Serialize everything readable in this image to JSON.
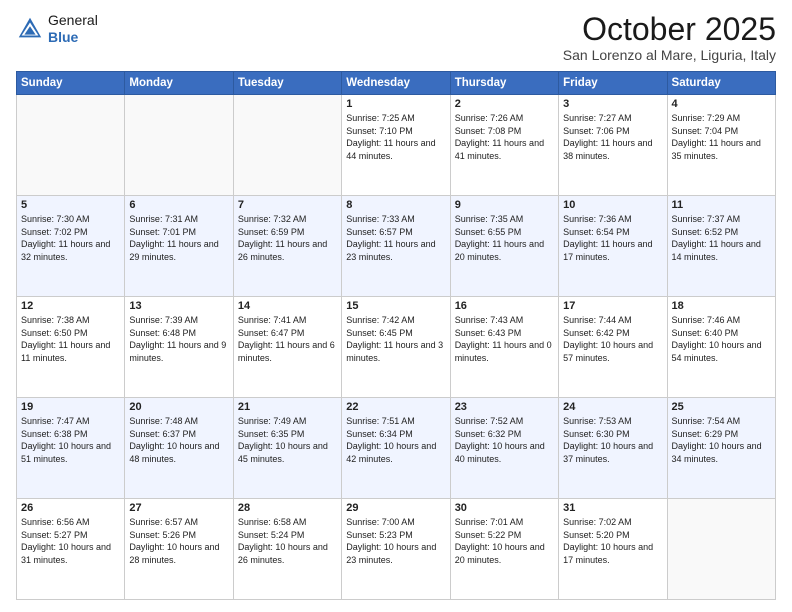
{
  "header": {
    "logo_general": "General",
    "logo_blue": "Blue",
    "month": "October 2025",
    "location": "San Lorenzo al Mare, Liguria, Italy"
  },
  "days_of_week": [
    "Sunday",
    "Monday",
    "Tuesday",
    "Wednesday",
    "Thursday",
    "Friday",
    "Saturday"
  ],
  "weeks": [
    [
      {
        "day": "",
        "sunrise": "",
        "sunset": "",
        "daylight": ""
      },
      {
        "day": "",
        "sunrise": "",
        "sunset": "",
        "daylight": ""
      },
      {
        "day": "",
        "sunrise": "",
        "sunset": "",
        "daylight": ""
      },
      {
        "day": "1",
        "sunrise": "Sunrise: 7:25 AM",
        "sunset": "Sunset: 7:10 PM",
        "daylight": "Daylight: 11 hours and 44 minutes."
      },
      {
        "day": "2",
        "sunrise": "Sunrise: 7:26 AM",
        "sunset": "Sunset: 7:08 PM",
        "daylight": "Daylight: 11 hours and 41 minutes."
      },
      {
        "day": "3",
        "sunrise": "Sunrise: 7:27 AM",
        "sunset": "Sunset: 7:06 PM",
        "daylight": "Daylight: 11 hours and 38 minutes."
      },
      {
        "day": "4",
        "sunrise": "Sunrise: 7:29 AM",
        "sunset": "Sunset: 7:04 PM",
        "daylight": "Daylight: 11 hours and 35 minutes."
      }
    ],
    [
      {
        "day": "5",
        "sunrise": "Sunrise: 7:30 AM",
        "sunset": "Sunset: 7:02 PM",
        "daylight": "Daylight: 11 hours and 32 minutes."
      },
      {
        "day": "6",
        "sunrise": "Sunrise: 7:31 AM",
        "sunset": "Sunset: 7:01 PM",
        "daylight": "Daylight: 11 hours and 29 minutes."
      },
      {
        "day": "7",
        "sunrise": "Sunrise: 7:32 AM",
        "sunset": "Sunset: 6:59 PM",
        "daylight": "Daylight: 11 hours and 26 minutes."
      },
      {
        "day": "8",
        "sunrise": "Sunrise: 7:33 AM",
        "sunset": "Sunset: 6:57 PM",
        "daylight": "Daylight: 11 hours and 23 minutes."
      },
      {
        "day": "9",
        "sunrise": "Sunrise: 7:35 AM",
        "sunset": "Sunset: 6:55 PM",
        "daylight": "Daylight: 11 hours and 20 minutes."
      },
      {
        "day": "10",
        "sunrise": "Sunrise: 7:36 AM",
        "sunset": "Sunset: 6:54 PM",
        "daylight": "Daylight: 11 hours and 17 minutes."
      },
      {
        "day": "11",
        "sunrise": "Sunrise: 7:37 AM",
        "sunset": "Sunset: 6:52 PM",
        "daylight": "Daylight: 11 hours and 14 minutes."
      }
    ],
    [
      {
        "day": "12",
        "sunrise": "Sunrise: 7:38 AM",
        "sunset": "Sunset: 6:50 PM",
        "daylight": "Daylight: 11 hours and 11 minutes."
      },
      {
        "day": "13",
        "sunrise": "Sunrise: 7:39 AM",
        "sunset": "Sunset: 6:48 PM",
        "daylight": "Daylight: 11 hours and 9 minutes."
      },
      {
        "day": "14",
        "sunrise": "Sunrise: 7:41 AM",
        "sunset": "Sunset: 6:47 PM",
        "daylight": "Daylight: 11 hours and 6 minutes."
      },
      {
        "day": "15",
        "sunrise": "Sunrise: 7:42 AM",
        "sunset": "Sunset: 6:45 PM",
        "daylight": "Daylight: 11 hours and 3 minutes."
      },
      {
        "day": "16",
        "sunrise": "Sunrise: 7:43 AM",
        "sunset": "Sunset: 6:43 PM",
        "daylight": "Daylight: 11 hours and 0 minutes."
      },
      {
        "day": "17",
        "sunrise": "Sunrise: 7:44 AM",
        "sunset": "Sunset: 6:42 PM",
        "daylight": "Daylight: 10 hours and 57 minutes."
      },
      {
        "day": "18",
        "sunrise": "Sunrise: 7:46 AM",
        "sunset": "Sunset: 6:40 PM",
        "daylight": "Daylight: 10 hours and 54 minutes."
      }
    ],
    [
      {
        "day": "19",
        "sunrise": "Sunrise: 7:47 AM",
        "sunset": "Sunset: 6:38 PM",
        "daylight": "Daylight: 10 hours and 51 minutes."
      },
      {
        "day": "20",
        "sunrise": "Sunrise: 7:48 AM",
        "sunset": "Sunset: 6:37 PM",
        "daylight": "Daylight: 10 hours and 48 minutes."
      },
      {
        "day": "21",
        "sunrise": "Sunrise: 7:49 AM",
        "sunset": "Sunset: 6:35 PM",
        "daylight": "Daylight: 10 hours and 45 minutes."
      },
      {
        "day": "22",
        "sunrise": "Sunrise: 7:51 AM",
        "sunset": "Sunset: 6:34 PM",
        "daylight": "Daylight: 10 hours and 42 minutes."
      },
      {
        "day": "23",
        "sunrise": "Sunrise: 7:52 AM",
        "sunset": "Sunset: 6:32 PM",
        "daylight": "Daylight: 10 hours and 40 minutes."
      },
      {
        "day": "24",
        "sunrise": "Sunrise: 7:53 AM",
        "sunset": "Sunset: 6:30 PM",
        "daylight": "Daylight: 10 hours and 37 minutes."
      },
      {
        "day": "25",
        "sunrise": "Sunrise: 7:54 AM",
        "sunset": "Sunset: 6:29 PM",
        "daylight": "Daylight: 10 hours and 34 minutes."
      }
    ],
    [
      {
        "day": "26",
        "sunrise": "Sunrise: 6:56 AM",
        "sunset": "Sunset: 5:27 PM",
        "daylight": "Daylight: 10 hours and 31 minutes."
      },
      {
        "day": "27",
        "sunrise": "Sunrise: 6:57 AM",
        "sunset": "Sunset: 5:26 PM",
        "daylight": "Daylight: 10 hours and 28 minutes."
      },
      {
        "day": "28",
        "sunrise": "Sunrise: 6:58 AM",
        "sunset": "Sunset: 5:24 PM",
        "daylight": "Daylight: 10 hours and 26 minutes."
      },
      {
        "day": "29",
        "sunrise": "Sunrise: 7:00 AM",
        "sunset": "Sunset: 5:23 PM",
        "daylight": "Daylight: 10 hours and 23 minutes."
      },
      {
        "day": "30",
        "sunrise": "Sunrise: 7:01 AM",
        "sunset": "Sunset: 5:22 PM",
        "daylight": "Daylight: 10 hours and 20 minutes."
      },
      {
        "day": "31",
        "sunrise": "Sunrise: 7:02 AM",
        "sunset": "Sunset: 5:20 PM",
        "daylight": "Daylight: 10 hours and 17 minutes."
      },
      {
        "day": "",
        "sunrise": "",
        "sunset": "",
        "daylight": ""
      }
    ]
  ]
}
